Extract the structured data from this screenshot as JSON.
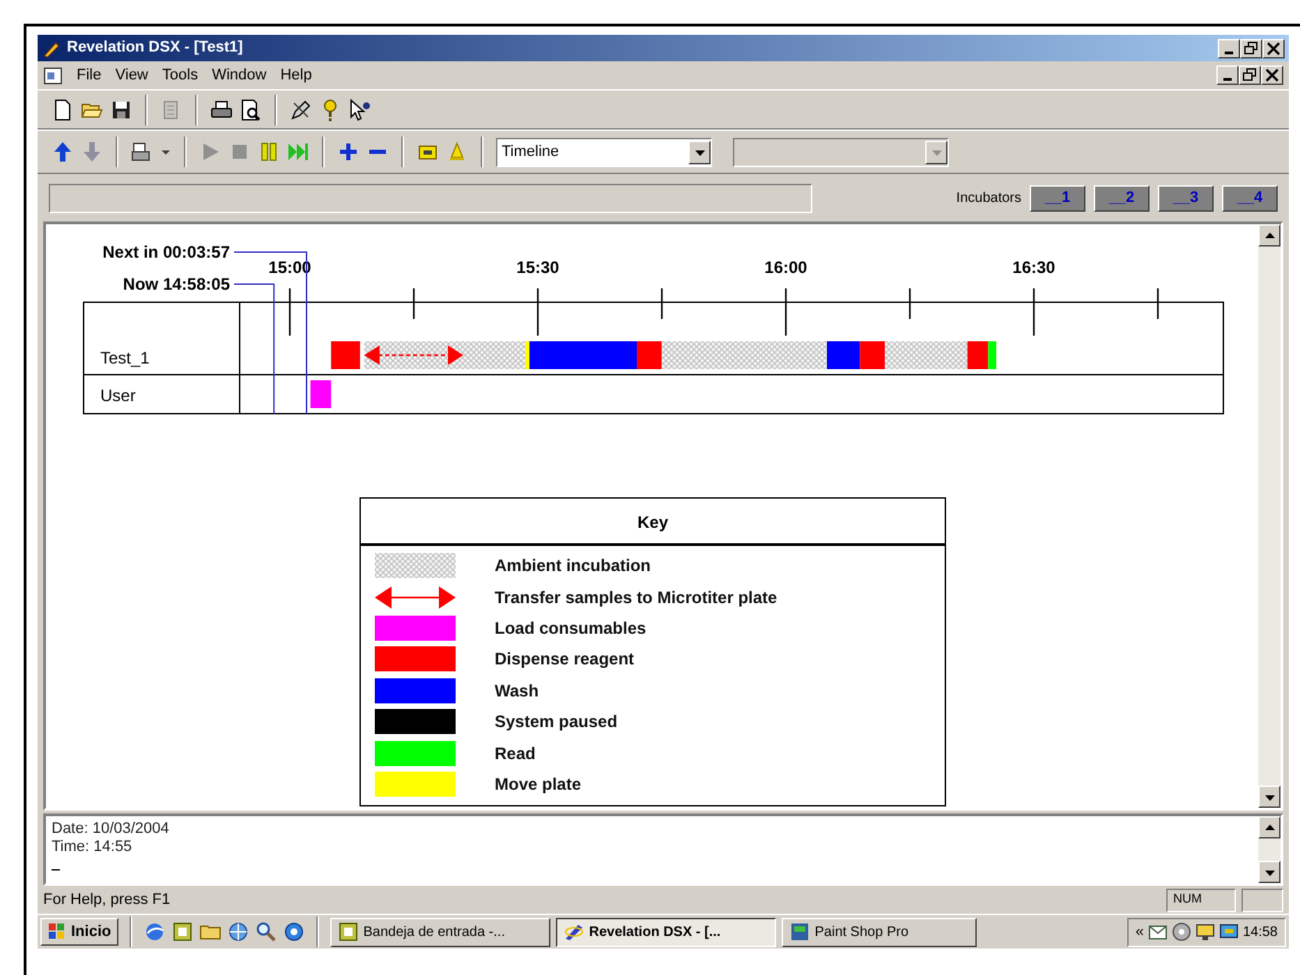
{
  "window": {
    "title": "Revelation DSX - [Test1]"
  },
  "menu": [
    "File",
    "View",
    "Tools",
    "Window",
    "Help"
  ],
  "view_combo": {
    "value": "Timeline"
  },
  "second_combo": {
    "disabled": true
  },
  "incubators": {
    "label": "Incubators",
    "buttons": [
      "__1",
      "__2",
      "__3",
      "__4"
    ]
  },
  "timeline": {
    "markers": [
      "Next in 00:03:57",
      "Now 14:58:05"
    ],
    "ticks": [
      "15:00",
      "15:30",
      "16:00",
      "16:30"
    ],
    "rows": [
      {
        "name": "Test_1",
        "segments": [
          {
            "kind": "solid",
            "color": "#ff0000"
          },
          {
            "kind": "arrow",
            "color": "#ff0000"
          },
          {
            "kind": "hatch"
          },
          {
            "kind": "solid",
            "color": "#ffff00"
          },
          {
            "kind": "solid",
            "color": "#0000ff"
          },
          {
            "kind": "solid",
            "color": "#ff0000"
          },
          {
            "kind": "hatch"
          },
          {
            "kind": "solid",
            "color": "#0000ff"
          },
          {
            "kind": "solid",
            "color": "#ff0000"
          },
          {
            "kind": "hatch"
          },
          {
            "kind": "solid",
            "color": "#ff0000"
          },
          {
            "kind": "solid",
            "color": "#00ff00"
          }
        ]
      },
      {
        "name": "User",
        "segments": [
          {
            "kind": "solid",
            "color": "#ff00ff"
          }
        ]
      }
    ]
  },
  "key": {
    "title": "Key",
    "items": [
      {
        "kind": "hatch",
        "label": "Ambient incubation"
      },
      {
        "kind": "arrow",
        "color": "#ff0000",
        "label": "Transfer samples to Microtiter plate"
      },
      {
        "kind": "solid",
        "color": "#ff00ff",
        "label": "Load consumables"
      },
      {
        "kind": "solid",
        "color": "#ff0000",
        "label": "Dispense reagent"
      },
      {
        "kind": "solid",
        "color": "#0000ff",
        "label": "Wash"
      },
      {
        "kind": "solid",
        "color": "#000000",
        "label": "System paused"
      },
      {
        "kind": "solid",
        "color": "#00ff00",
        "label": "Read"
      },
      {
        "kind": "solid",
        "color": "#ffff00",
        "label": "Move plate"
      }
    ]
  },
  "log": [
    "Date: 10/03/2004",
    "Time: 14:55"
  ],
  "status_bar": {
    "text": "For Help, press F1",
    "indicator": "NUM"
  },
  "taskbar": {
    "start": "Inicio",
    "tasks": [
      {
        "label": "Bandeja de entrada -...",
        "selected": false
      },
      {
        "label": "Revelation DSX - [...",
        "selected": true
      },
      {
        "label": "Paint Shop Pro",
        "selected": false
      }
    ],
    "tray_toggle": "«",
    "clock": "14:58"
  }
}
